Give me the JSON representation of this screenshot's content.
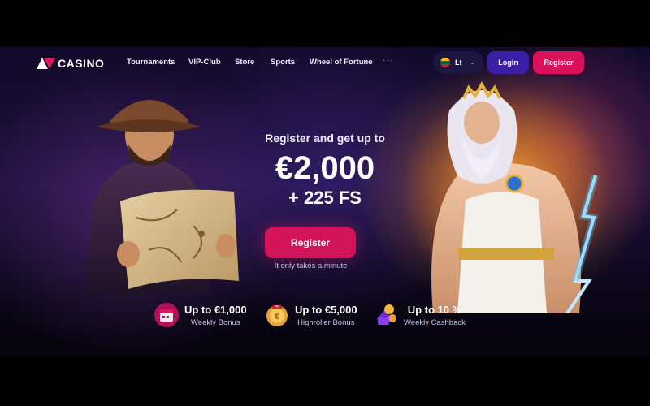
{
  "brand": {
    "logo_text": "CASINO"
  },
  "nav": {
    "items": [
      "Tournaments",
      "VIP-Club",
      "Store",
      "Sports",
      "Wheel of Fortune"
    ],
    "more": "···"
  },
  "language": {
    "label": "Lt"
  },
  "header_actions": {
    "login": "Login",
    "register": "Register"
  },
  "hero": {
    "subtitle": "Register and get up to",
    "amount": "€2,000",
    "free_spins": "+ 225 FS",
    "cta": "Register",
    "note": "It only takes a minute"
  },
  "bonuses": [
    {
      "title": "Up to €1,000",
      "subtitle": "Weekly Bonus",
      "icon": "calendar-gift-icon"
    },
    {
      "title": "Up to €5,000",
      "subtitle": "Highroller Bonus",
      "icon": "crown-coin-icon"
    },
    {
      "title": "Up to 10 %",
      "subtitle": "Weekly Cashback",
      "icon": "cashback-icon"
    }
  ],
  "colors": {
    "accent": "#d9115a",
    "login": "#3a1fa6",
    "background": "#120a2a"
  }
}
